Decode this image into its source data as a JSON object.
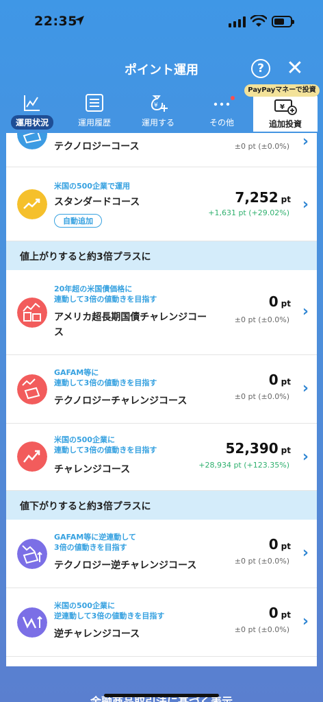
{
  "status": {
    "time": "22:35"
  },
  "header": {
    "title": "ポイント運用",
    "help": "?",
    "close": "✕"
  },
  "tabs": [
    {
      "label": "運用状況",
      "active": true
    },
    {
      "label": "運用履歴"
    },
    {
      "label": "運用する"
    },
    {
      "label": "その他",
      "dot": true
    }
  ],
  "add_tab": {
    "badge": "PayPayマネーで投資",
    "label": "追加投資"
  },
  "rows": {
    "tech": {
      "name": "テクノロジーコース",
      "delta": "±0 pt (±0.0%)",
      "chevron": "›"
    },
    "standard": {
      "lead": "米国の500企業で運用",
      "name": "スタンダードコース",
      "amount": "7,252",
      "unit": "pt",
      "delta": "+1,631 pt (+29.02%)",
      "badge": "自動追加",
      "chevron": "›"
    },
    "section_up": "値上がりすると約3倍プラスに",
    "us_bond": {
      "lead1": "20年超の米国債価格に",
      "lead2": "連動して3倍の値動きを目指す",
      "name1": "アメリカ超長期国債チャレンジコー",
      "name2": "ス",
      "amount": "0",
      "unit": "pt",
      "delta": "±0 pt (±0.0%)",
      "chevron": "›"
    },
    "tech_challenge": {
      "lead1": "GAFAM等に",
      "lead2": "連動して3倍の値動きを目指す",
      "name": "テクノロジーチャレンジコース",
      "amount": "0",
      "unit": "pt",
      "delta": "±0 pt (±0.0%)",
      "chevron": "›"
    },
    "challenge": {
      "lead1": "米国の500企業に",
      "lead2": "連動して3倍の値動きを目指す",
      "name": "チャレンジコース",
      "amount": "52,390",
      "unit": "pt",
      "delta": "+28,934 pt (+123.35%)",
      "chevron": "›"
    },
    "section_down": "値下がりすると約3倍プラスに",
    "tech_inverse": {
      "lead1": "GAFAM等に逆連動して",
      "lead2": "3倍の値動きを目指す",
      "name": "テクノロジー逆チャレンジコース",
      "amount": "0",
      "unit": "pt",
      "delta": "±0 pt (±0.0%)",
      "chevron": "›"
    },
    "inverse": {
      "lead1": "米国の500企業に",
      "lead2": "逆連動して3倍の値動きを目指す",
      "name": "逆チャレンジコース",
      "amount": "0",
      "unit": "pt",
      "delta": "±0 pt (±0.0%)",
      "chevron": "›"
    }
  },
  "footer": {
    "text": "金融商品取引法に基づく表示"
  },
  "colors": {
    "accent": "#36a1e0",
    "positive": "#2fb06e",
    "section_bg": "#d4ecfa",
    "nav_active": "#1e4e96",
    "badge": "#f3e29a"
  },
  "icons": {
    "tech": "laptop-icon",
    "standard": "trend-up-icon",
    "us_bond": "bond-chart-icon",
    "tech_challenge": "laptop-chart-icon",
    "challenge": "trend-up-icon",
    "tech_inverse": "laptop-inverse-icon",
    "inverse": "trend-inverse-icon"
  }
}
